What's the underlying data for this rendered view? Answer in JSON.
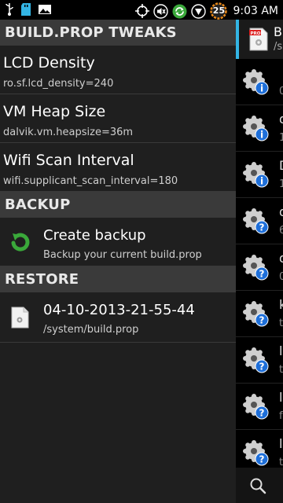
{
  "status_bar": {
    "time": "9:03 AM",
    "battery_badge": "25",
    "icons_left": [
      "usb-icon",
      "sd-card-icon",
      "image-icon"
    ],
    "icons_right": [
      "crosshair-icon",
      "volume-mute-icon",
      "sync-icon",
      "vibrate-icon",
      "battery-badge-icon"
    ]
  },
  "sections": [
    {
      "header": "BUILD.PROP TWEAKS",
      "items": [
        {
          "title": "LCD Density",
          "subtitle": "ro.sf.lcd_density=240"
        },
        {
          "title": "VM Heap Size",
          "subtitle": "dalvik.vm.heapsize=36m"
        },
        {
          "title": "Wifi Scan Interval",
          "subtitle": "wifi.supplicant_scan_interval=180"
        }
      ]
    },
    {
      "header": "BACKUP",
      "items": [
        {
          "title": "Create backup",
          "subtitle": "Backup your current build.prop",
          "icon": "refresh-arrow-icon"
        }
      ]
    },
    {
      "header": "RESTORE",
      "items": [
        {
          "title": "04-10-2013-21-55-44",
          "subtitle": "/system/build.prop",
          "icon": "file-icon"
        }
      ]
    }
  ],
  "right_pane": {
    "top_item": {
      "line1": "B",
      "line2": "/s",
      "icon": "prop-file-icon",
      "accent": "#33b5e5"
    },
    "rows": [
      {
        "t1": "",
        "t2": "0",
        "badge": "info"
      },
      {
        "t1": "d",
        "t2": "1",
        "badge": "info"
      },
      {
        "t1": "D",
        "t2": "1",
        "badge": "info"
      },
      {
        "t1": "d",
        "t2": "6",
        "badge": "help"
      },
      {
        "t1": "d",
        "t2": "0",
        "badge": "help"
      },
      {
        "t1": "k",
        "t2": "t",
        "badge": "help"
      },
      {
        "t1": "l",
        "t2": "t",
        "badge": "help"
      },
      {
        "t1": "l",
        "t2": "f",
        "badge": "help"
      },
      {
        "t1": "l",
        "t2": "t",
        "badge": "help"
      },
      {
        "t1": "l",
        "t2": "",
        "badge": "help"
      }
    ],
    "bottom_icon": "search-icon"
  },
  "colors": {
    "accent": "#33b5e5",
    "header_bg": "#3a3a3a",
    "list_bg": "#1f1f1f",
    "info_blue": "#1e6fd9",
    "green": "#3aa83a"
  }
}
